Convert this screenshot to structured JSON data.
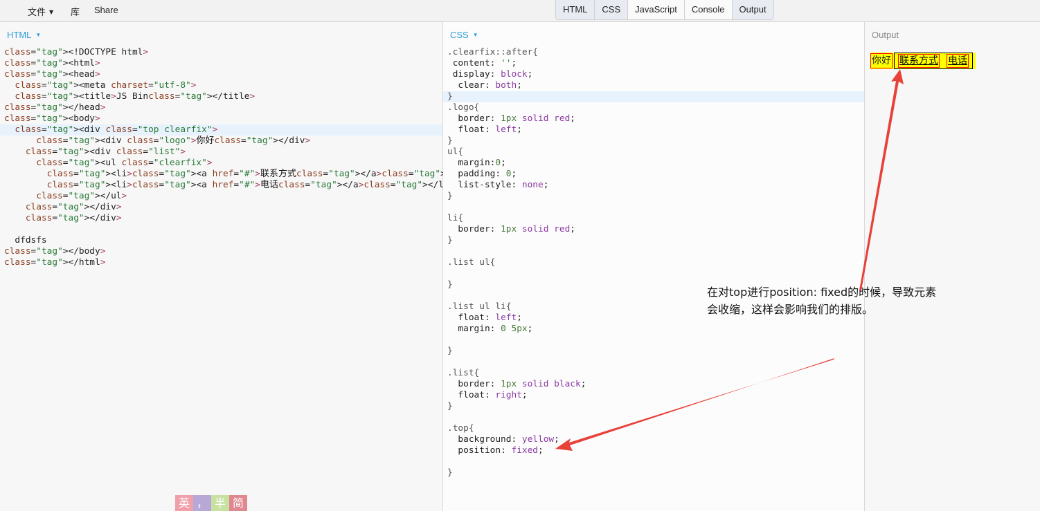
{
  "menu": {
    "file_label": "文件",
    "library_label": "库",
    "share_label": "Share"
  },
  "tabs": [
    "HTML",
    "CSS",
    "JavaScript",
    "Console",
    "Output"
  ],
  "panels": {
    "html_label": "HTML",
    "css_label": "CSS",
    "output_label": "Output"
  },
  "html_code": [
    "<!DOCTYPE html>",
    "<html>",
    "<head>",
    "  <meta charset=\"utf-8\">",
    "  <title>JS Bin</title>",
    "</head>",
    "<body>",
    "  <div class=\"top clearfix\">",
    "      <div class=\"logo\">你好</div>",
    "    <div class=\"list\">",
    "      <ul class=\"clearfix\">",
    "        <li><a href=\"#\">联系方式</a></li>",
    "        <li><a href=\"#\">电话</a></li>",
    "      </ul>",
    "    </div>",
    "    </div>",
    "",
    "  dfdsfs",
    "</body>",
    "</html>"
  ],
  "css_code": [
    ".clearfix::after{",
    " content: '';",
    " display: block;",
    "  clear: both;",
    "}",
    ".logo{",
    "  border: 1px solid red;",
    "  float: left;",
    "}",
    "ul{",
    "  margin:0;",
    "  padding: 0;",
    "  list-style: none;",
    "}",
    "",
    "li{",
    "  border: 1px solid red;",
    "}",
    "",
    ".list ul{",
    "",
    "}",
    "",
    ".list ul li{",
    "  float: left;",
    "  margin: 0 5px;",
    "",
    "}",
    "",
    ".list{",
    "  border: 1px solid black;",
    "  float: right;",
    "}",
    "",
    ".top{",
    "  background: yellow;",
    "  position: fixed;",
    "",
    "}"
  ],
  "output": {
    "logo_text": "你好",
    "links": [
      "联系方式",
      "电话"
    ]
  },
  "annotation": {
    "line1": "在对top进行position: fixed的时候，导致元素",
    "line2": "会收缩，这样会影响我们的排版。"
  },
  "ime": {
    "chars": [
      "英",
      "，",
      "半",
      "简"
    ],
    "colors": [
      "#f0a0a8",
      "#b8a8d8",
      "#c8e0a0",
      "#e08890"
    ]
  },
  "colors": {
    "arrow": "#e8413a",
    "label_accent": "#2d9cdb",
    "highlight": "#e8f2fc"
  }
}
